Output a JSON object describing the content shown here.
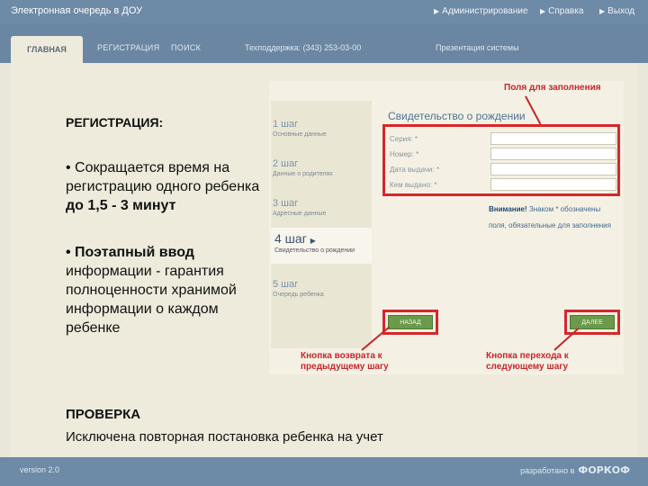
{
  "topbar": {
    "title": "Электронная очередь в ДОУ",
    "links": [
      "Администрирование",
      "Справка",
      "Выход"
    ]
  },
  "nav": {
    "tabs": [
      "ГЛАВНАЯ",
      "РЕГИСТРАЦИЯ",
      "ПОИСК"
    ],
    "support": "Техподдержка: (343) 253-03-00",
    "presentation": "Презентация системы"
  },
  "slide": {
    "reg_title": "РЕГИСТРАЦИЯ:",
    "bullet1_prefix": "• Сокращается время на регистрацию одного ребенка ",
    "bullet1_bold": "до 1,5 - 3 минут",
    "bullet2_bold": "• Поэтапный ввод",
    "bullet2_rest": " информации - гарантия полноценности хранимой информации о каждом ребенке",
    "check_title": "ПРОВЕРКА",
    "check_text": "Исключена повторная постановка ребенка на учет"
  },
  "shot": {
    "steps": [
      {
        "num": "1 шаг",
        "desc": "Основные данные"
      },
      {
        "num": "2 шаг",
        "desc": "Данные о родителях"
      },
      {
        "num": "3 шаг",
        "desc": "Адресные данные"
      },
      {
        "num": "4 шаг",
        "desc": "Свидетельство о рождении"
      },
      {
        "num": "5 шаг",
        "desc": "Очередь ребенка"
      }
    ],
    "active_step": 4,
    "form_title": "Свидетельство о рождении",
    "fields": [
      "Серия: *",
      "Номер: *",
      "Дата выдачи: *",
      "Кем выдано: *"
    ],
    "warn_bold": "Внимание!",
    "warn_text": " Знаком * обозначены поля, обязательные для заполнения",
    "back_label": "НАЗАД",
    "next_label": "ДАЛЕЕ"
  },
  "notes": {
    "fields_note": "Поля для заполнения",
    "back_note_1": "Кнопка возврата к",
    "back_note_2": "предыдущему шагу",
    "next_note_1": "Кнопка перехода к",
    "next_note_2": "следующему шагу"
  },
  "footer": {
    "version": "version 2.0",
    "developed": "разработано в",
    "logo": "ФОРКОФ"
  },
  "colors": {
    "header": "#6d8aa6",
    "background": "#e9e7d9",
    "accent_red": "#d8262a",
    "button_green": "#6a9a4a"
  }
}
